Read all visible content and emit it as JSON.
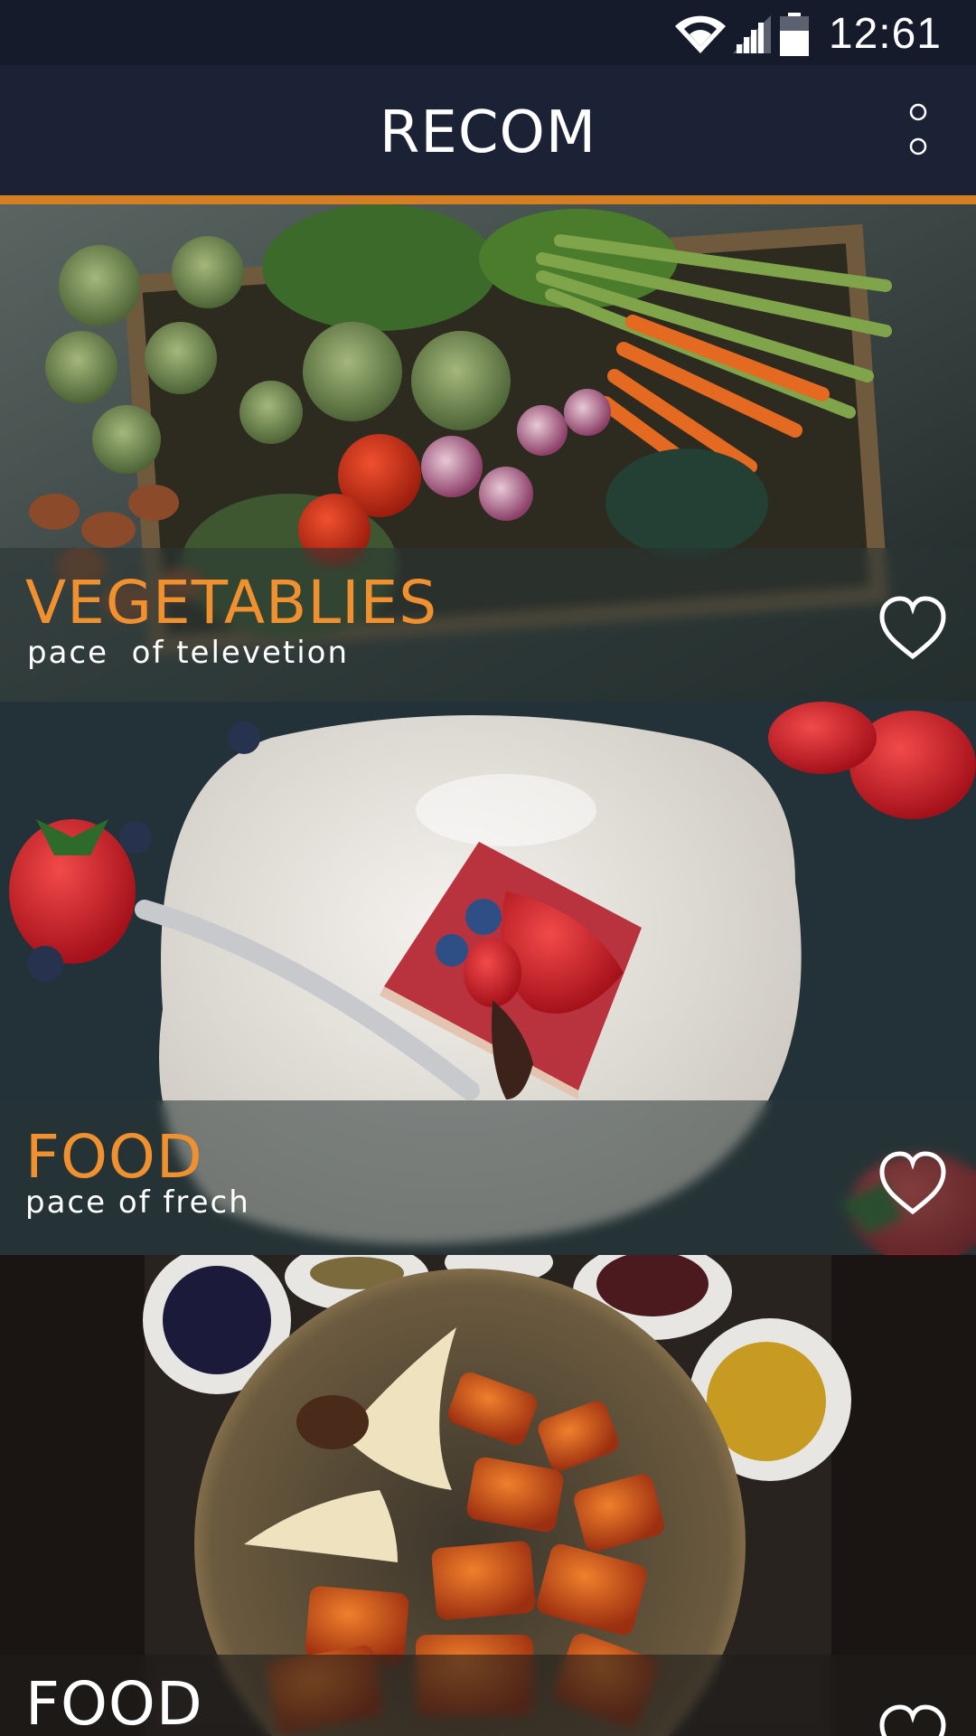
{
  "status_bar": {
    "time": "12:61",
    "icons": [
      "wifi-icon",
      "signal-icon",
      "battery-icon"
    ]
  },
  "app_bar": {
    "title": "RECOM",
    "menu_icon": "more-vertical-icon"
  },
  "colors": {
    "accent": "#d77d22",
    "title_orange": "#f0902e",
    "app_bar_bg": "#1c2236",
    "status_bar_bg": "#151b2a"
  },
  "cards": [
    {
      "title": "VEGETABLIES",
      "subtitle": "pace  of televetion",
      "favorite_icon": "heart-outline-icon",
      "image": "vegetables-photo"
    },
    {
      "title": "FOOD",
      "subtitle": "pace of frech",
      "favorite_icon": "heart-outline-icon",
      "image": "strawberry-cake-photo"
    },
    {
      "title": "FOOD",
      "subtitle": "",
      "favorite_icon": "heart-outline-icon",
      "image": "roast-duck-photo"
    }
  ]
}
